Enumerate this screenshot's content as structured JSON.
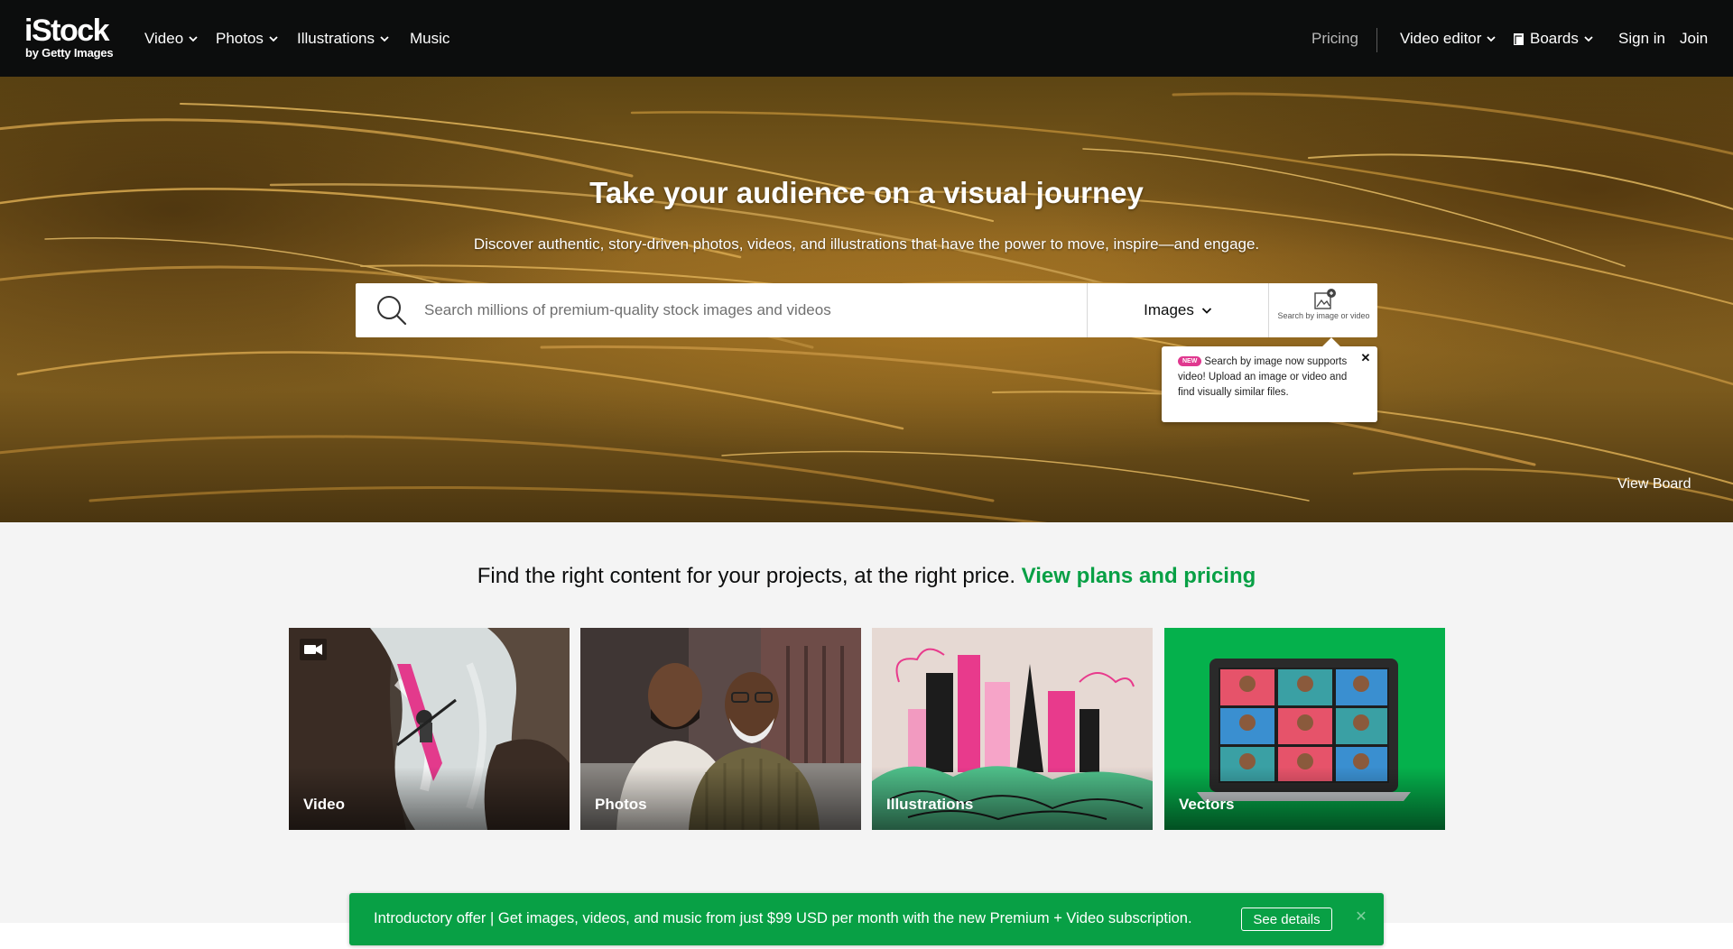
{
  "brand": {
    "name": "iStock",
    "tagline": "by Getty Images"
  },
  "nav": {
    "left": [
      {
        "label": "Video",
        "has_dropdown": true
      },
      {
        "label": "Photos",
        "has_dropdown": true
      },
      {
        "label": "Illustrations",
        "has_dropdown": true
      },
      {
        "label": "Music",
        "has_dropdown": false
      }
    ],
    "right": {
      "pricing": "Pricing",
      "video_editor": "Video editor",
      "boards": "Boards",
      "sign_in": "Sign in",
      "join": "Join"
    }
  },
  "hero": {
    "title": "Take your audience on a visual journey",
    "subtitle": "Discover authentic, story-driven photos, videos, and illustrations that have the power to move, inspire—and engage.",
    "search": {
      "placeholder": "Search millions of premium-quality stock images and videos",
      "value": "",
      "type_selected": "Images",
      "image_search_label": "Search by image or video"
    },
    "tooltip": {
      "badge": "NEW",
      "text": "Search by image now supports video! Upload an image or video and find visually similar files.",
      "close": "✕"
    },
    "view_board": "View Board"
  },
  "promo": {
    "text": "Find the right content for your projects, at the right price.",
    "link": "View plans and pricing"
  },
  "tiles": [
    {
      "label": "Video",
      "icon": "video-camera-icon"
    },
    {
      "label": "Photos"
    },
    {
      "label": "Illustrations"
    },
    {
      "label": "Vectors"
    }
  ],
  "banner": {
    "text": "Introductory offer | Get images, videos, and music from just $99 USD per month with the new Premium + Video subscription.",
    "button": "See details",
    "close": "✕"
  },
  "colors": {
    "nav_bg": "#0c0d0d",
    "accent_green": "#08a045",
    "badge_pink": "#e0388f",
    "vectors_bg": "#05b14c"
  }
}
